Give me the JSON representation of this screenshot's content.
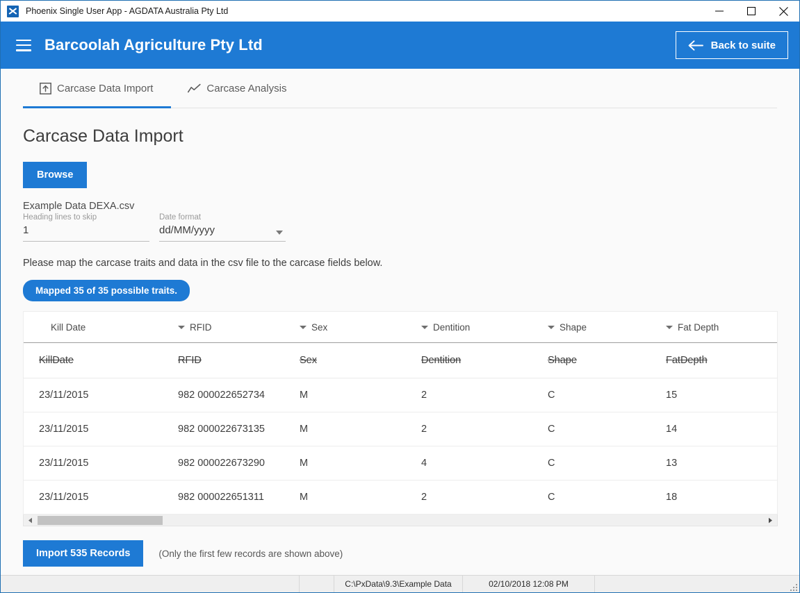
{
  "window": {
    "title": "Phoenix Single User App - AGDATA Australia Pty Ltd",
    "app_icon": "phoenix-logo-icon",
    "minimize_label": "Minimize",
    "maximize_label": "Maximize",
    "close_label": "Close"
  },
  "appbar": {
    "menu_icon": "hamburger-menu-icon",
    "title": "Barcoolah Agriculture Pty Ltd",
    "back_button": {
      "label": "Back to suite",
      "icon": "arrow-left-icon"
    },
    "background_color": "#1e7ad4"
  },
  "tabs": [
    {
      "label": "Carcase Data Import",
      "icon": "import-upload-icon",
      "active": true
    },
    {
      "label": "Carcase Analysis",
      "icon": "line-chart-icon",
      "active": false
    }
  ],
  "main": {
    "page_title": "Carcase Data Import",
    "browse_button": "Browse",
    "file_name": "Example Data DEXA.csv",
    "heading_lines": {
      "label": "Heading lines to skip",
      "value": "1"
    },
    "date_format": {
      "label": "Date format",
      "value": "dd/MM/yyyy",
      "caret_icon": "chevron-down-icon"
    },
    "instruction": "Please map the carcase traits and data in the csv file to the carcase fields below.",
    "mapped_badge": "Mapped 35 of 35 possible traits.",
    "import_button": "Import 535 Records",
    "import_note": "(Only the first few records are shown above)"
  },
  "table": {
    "selectors": [
      {
        "label": "Kill Date",
        "caret": false
      },
      {
        "label": "RFID",
        "caret": true
      },
      {
        "label": "Sex",
        "caret": true
      },
      {
        "label": "Dentition",
        "caret": true
      },
      {
        "label": "Shape",
        "caret": true
      },
      {
        "label": "Fat Depth",
        "caret": true
      }
    ],
    "csv_headers": [
      "KillDate",
      "RFID",
      "Sex",
      "Dentition",
      "Shape",
      "FatDepth"
    ],
    "rows": [
      [
        "23/11/2015",
        "982 000022652734",
        "M",
        "2",
        "C",
        "15"
      ],
      [
        "23/11/2015",
        "982 000022673135",
        "M",
        "2",
        "C",
        "14"
      ],
      [
        "23/11/2015",
        "982 000022673290",
        "M",
        "4",
        "C",
        "13"
      ],
      [
        "23/11/2015",
        "982 000022651311",
        "M",
        "2",
        "C",
        "18"
      ]
    ],
    "scrollbar": {
      "left_arrow_icon": "triangle-left-icon",
      "right_arrow_icon": "triangle-right-icon"
    }
  },
  "statusbar": {
    "path": "C:\\PxData\\9.3\\Example Data",
    "datetime": "02/10/2018  12:08 PM",
    "resize_grip_icon": "resize-grip-icon"
  }
}
